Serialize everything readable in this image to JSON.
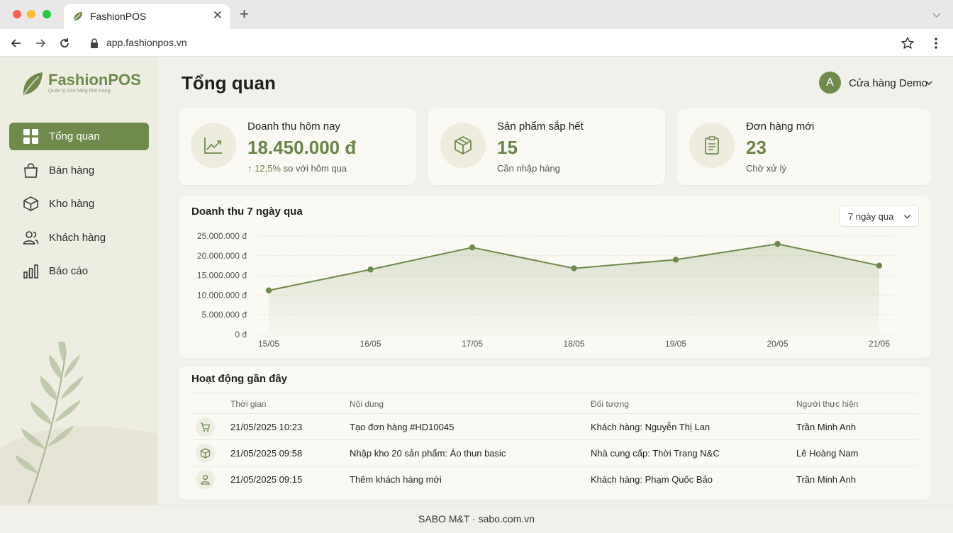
{
  "browser": {
    "tab_title": "FashionPOS",
    "url": "app.fashionpos.vn"
  },
  "sidebar": {
    "logo_name": "FashionPOS",
    "logo_tagline": "Quản lý cửa hàng thời trang",
    "items": [
      {
        "label": "Tổng quan",
        "icon": "grid-icon",
        "active": true
      },
      {
        "label": "Bán hàng",
        "icon": "shopping-bag-icon",
        "active": false
      },
      {
        "label": "Kho hàng",
        "icon": "box-icon",
        "active": false
      },
      {
        "label": "Khách hàng",
        "icon": "users-icon",
        "active": false
      },
      {
        "label": "Báo cáo",
        "icon": "bar-chart-icon",
        "active": false
      }
    ]
  },
  "header": {
    "title": "Tổng quan",
    "user_initial": "A",
    "user_name": "Cửa hàng Demo"
  },
  "stats": [
    {
      "label": "Doanh thu hôm nay",
      "value": "18.450.000 đ",
      "sub_arrow": "↑",
      "sub_value": "12,5%",
      "sub_text": "so với hôm qua",
      "icon": "trend-up-icon"
    },
    {
      "label": "Sản phẩm sắp hết",
      "value": "15",
      "sub_text": "Cần nhập hàng",
      "icon": "package-icon"
    },
    {
      "label": "Đơn hàng mới",
      "value": "23",
      "sub_text": "Chờ xử lý",
      "icon": "clipboard-icon"
    }
  ],
  "chart": {
    "title": "Doanh thu 7 ngày qua",
    "range_label": "7 ngày qua"
  },
  "chart_data": {
    "type": "area",
    "categories": [
      "15/05",
      "16/05",
      "17/05",
      "18/05",
      "19/05",
      "20/05",
      "21/05"
    ],
    "values": [
      11200000,
      16500000,
      22100000,
      16800000,
      19000000,
      23000000,
      17500000
    ],
    "ylim": [
      0,
      25000000
    ],
    "yticks": [
      "0 đ",
      "5.000.000 đ",
      "10.000.000 đ",
      "15.000.000 đ",
      "20.000.000 đ",
      "25.000.000 đ"
    ],
    "grid": true,
    "color": "#6f8a4c"
  },
  "activity": {
    "title": "Hoạt động gần đây",
    "columns": [
      "Thời gian",
      "Nội dung",
      "Đối tượng",
      "Người thực hiện"
    ],
    "rows": [
      {
        "icon": "cart-icon",
        "time": "21/05/2025 10:23",
        "content": "Tạo đơn hàng #HD10045",
        "target": "Khách hàng: Nguyễn Thị Lan",
        "actor": "Trần Minh Anh"
      },
      {
        "icon": "package-icon",
        "time": "21/05/2025 09:58",
        "content": "Nhập kho 20 sản phẩm: Áo thun basic",
        "target": "Nhà cung cấp: Thời Trang N&C",
        "actor": "Lê Hoàng Nam"
      },
      {
        "icon": "user-icon",
        "time": "21/05/2025 09:15",
        "content": "Thêm khách hàng mới",
        "target": "Khách hàng: Phạm Quốc Bảo",
        "actor": "Trần Minh Anh"
      }
    ]
  },
  "footer": {
    "text": "SABO M&T · sabo.com.vn"
  }
}
